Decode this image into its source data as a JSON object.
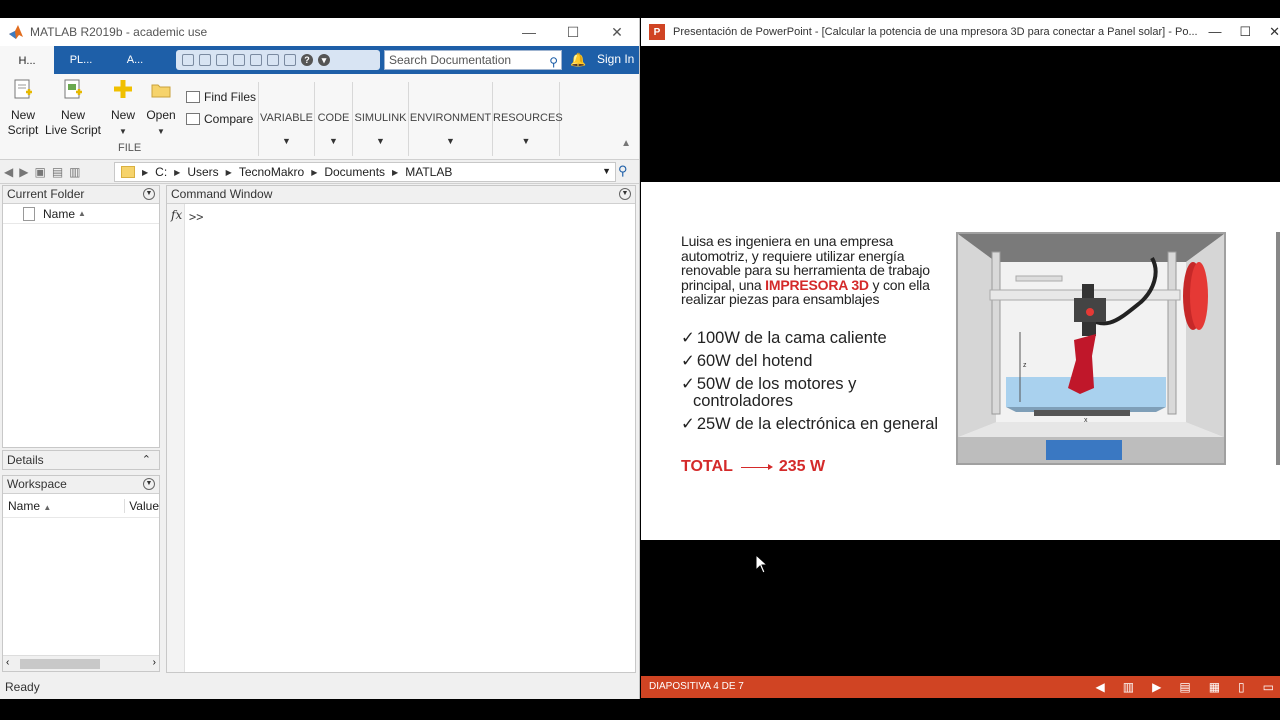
{
  "matlab": {
    "title": "MATLAB R2019b - academic use",
    "tabs": [
      "H...",
      "PL...",
      "A..."
    ],
    "search_placeholder": "Search Documentation",
    "sign_in": "Sign In",
    "ribbon": {
      "new_script": "New\nScript",
      "new_live_script": "New\nLive Script",
      "new": "New",
      "open": "Open",
      "find_files": "Find Files",
      "compare": "Compare",
      "file_group": "FILE",
      "sections": [
        "VARIABLE",
        "CODE",
        "SIMULINK",
        "ENVIRONMENT",
        "RESOURCES"
      ]
    },
    "path": [
      "C:",
      "Users",
      "TecnoMakro",
      "Documents",
      "MATLAB"
    ],
    "current_folder": {
      "title": "Current Folder",
      "col_name": "Name"
    },
    "command_window": {
      "title": "Command Window",
      "fx": "fx",
      "prompt": ">>"
    },
    "details": {
      "title": "Details"
    },
    "workspace": {
      "title": "Workspace",
      "col_name": "Name",
      "col_value": "Value"
    },
    "status": "Ready"
  },
  "ppt": {
    "title": "Presentación de PowerPoint - [Calcular la potencia de una mpresora 3D para conectar a Panel solar] - Po...",
    "slide": {
      "intro_before": "Luisa es ingeniera en una empresa automotriz, y requiere utilizar energía renovable para su herramienta de trabajo principal, una ",
      "intro_highlight": "IMPRESORA 3D",
      "intro_after": " y con ella realizar piezas para ensamblajes",
      "items": [
        "100W de la cama caliente",
        "60W del hotend",
        "50W de los motores y controladores",
        "25W de la electrónica en general"
      ],
      "total_label": "TOTAL",
      "total_value": "235 W"
    },
    "status": "DIAPOSITIVA 4 DE 7"
  },
  "colors": {
    "matlab_blue": "#1e5fa8",
    "ppt_red": "#d04423",
    "highlight_red": "#d42a2a"
  }
}
